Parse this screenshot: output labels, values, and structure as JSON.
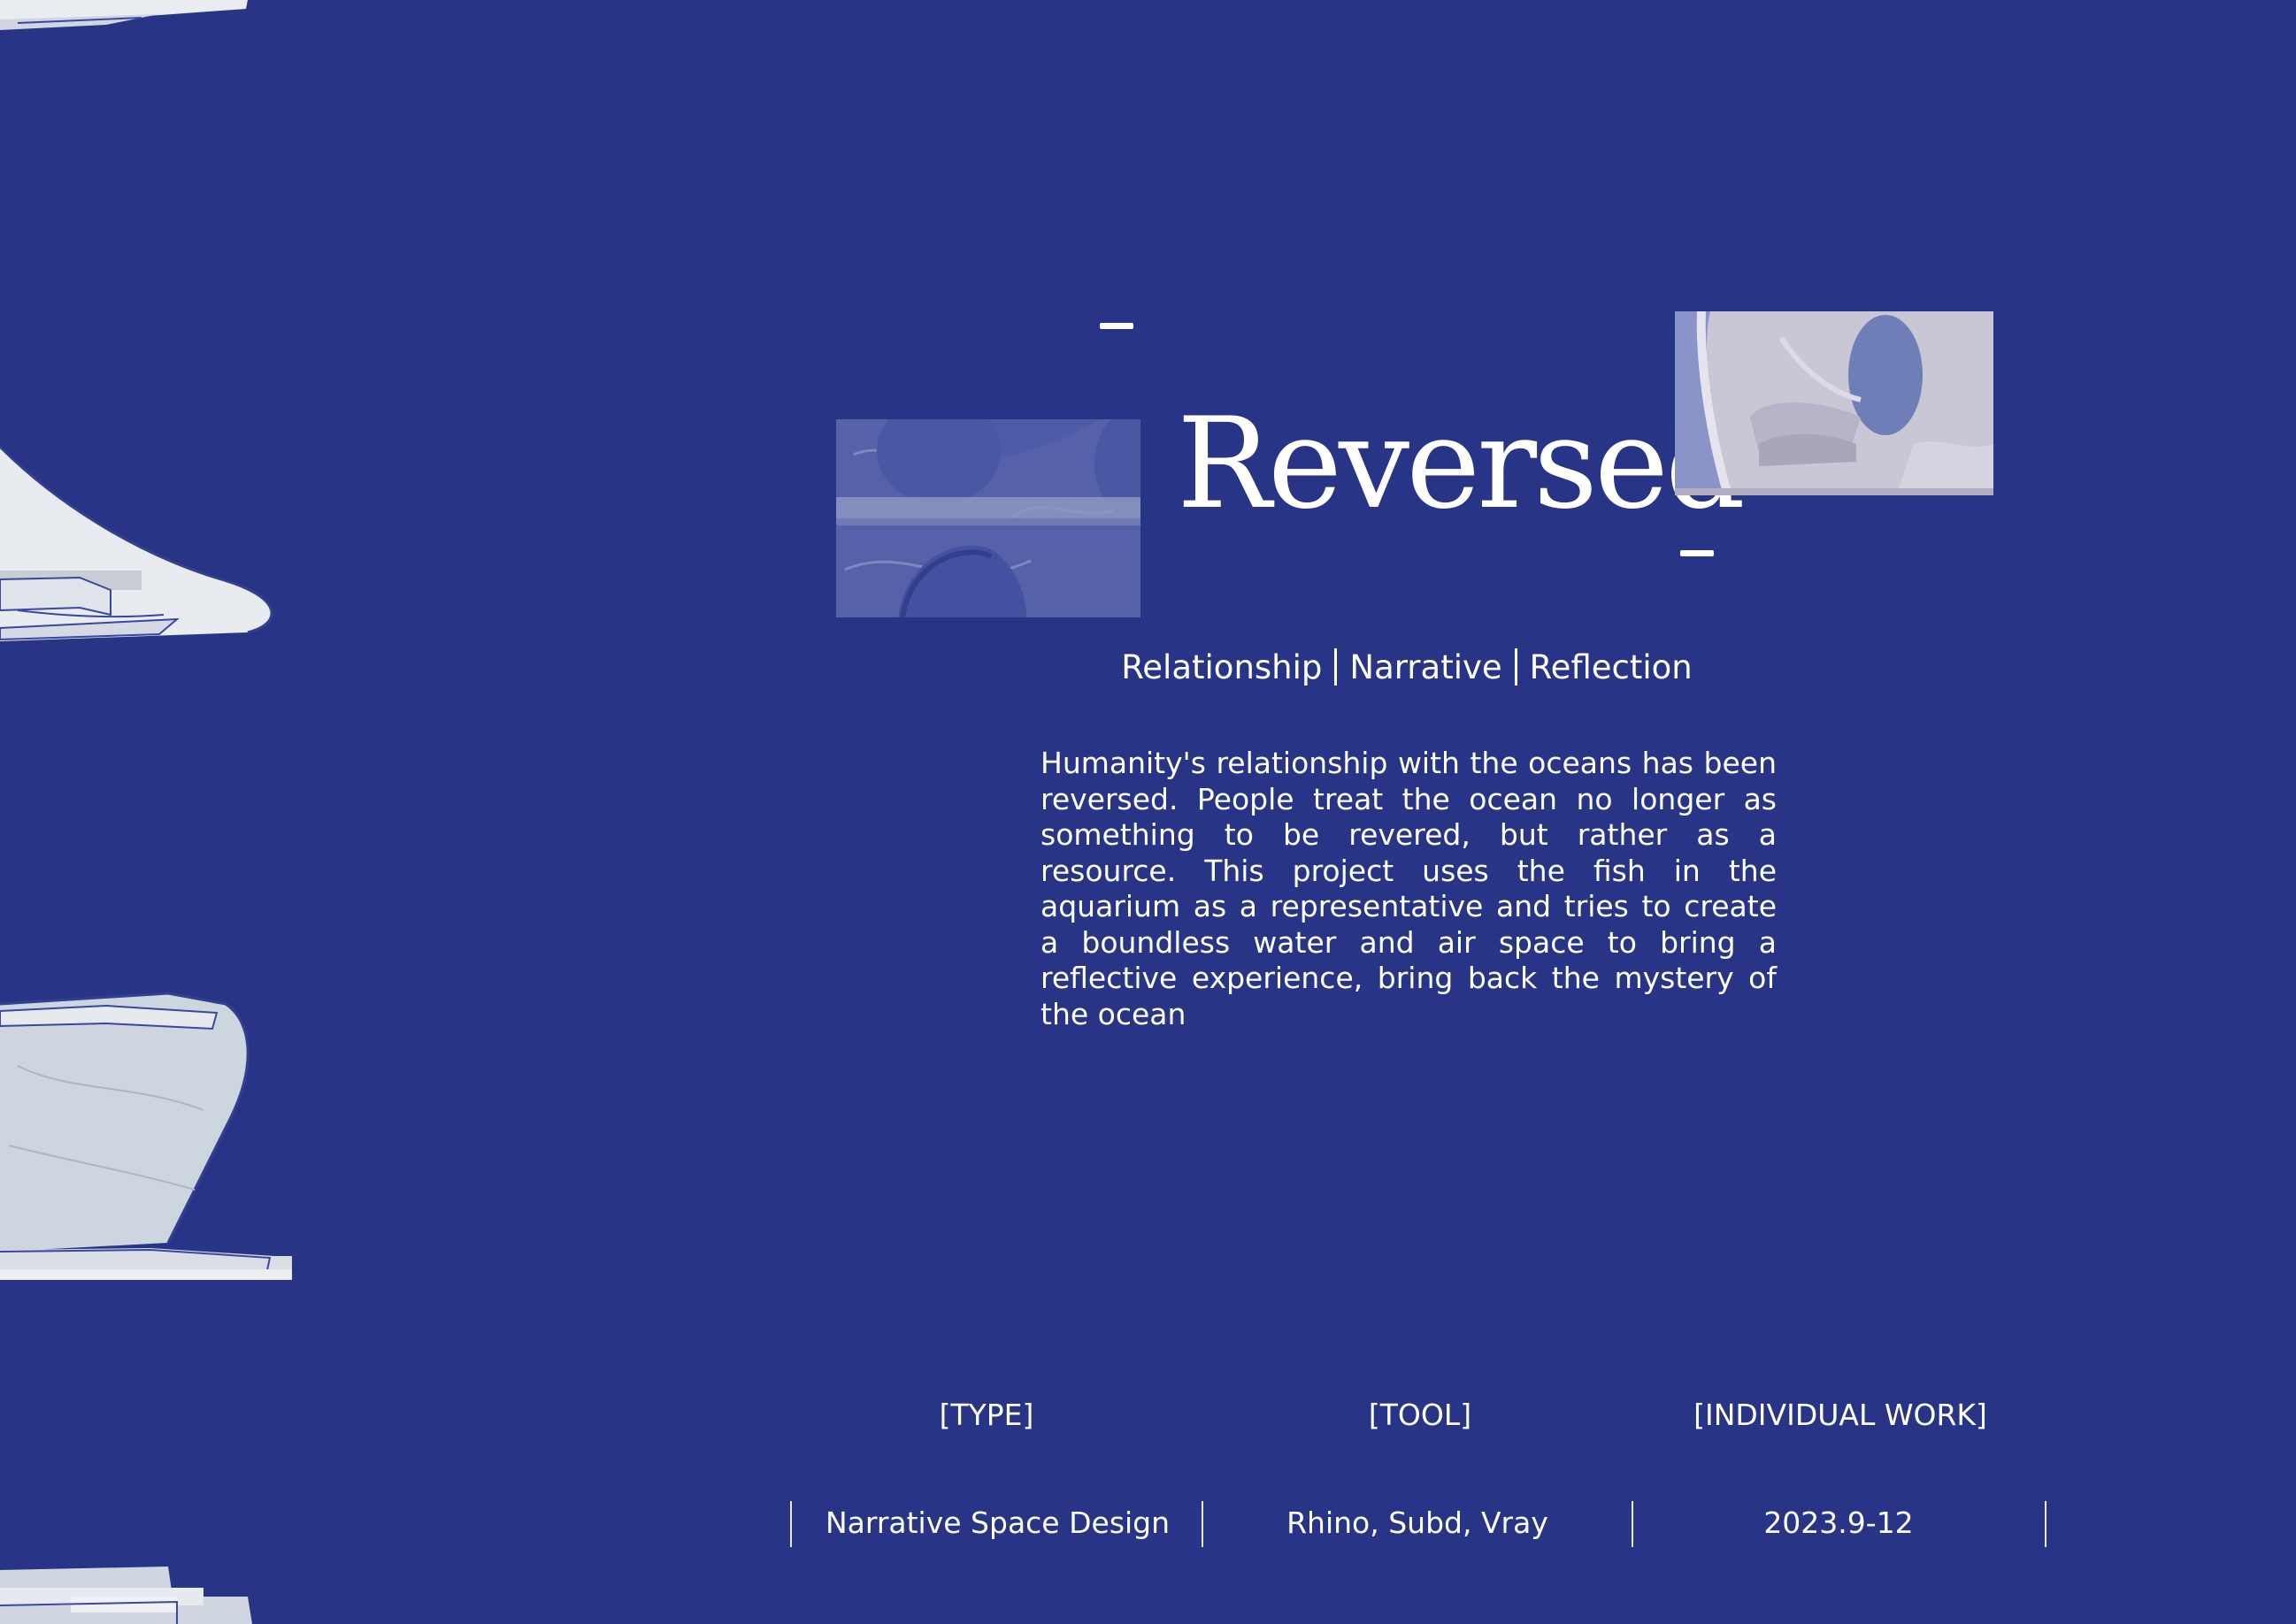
{
  "colors": {
    "background": "#283586",
    "text": "#ffffff",
    "thumb_water": "#4e5ba6",
    "thumb_render": "#c9c6d6"
  },
  "title": "Reversed",
  "tags": [
    "Relationship",
    "Narrative",
    "Reflection"
  ],
  "description": "Humanity's relationship with the oceans has been reversed. People treat the ocean no longer as something to be revered, but rather as a resource. This project uses the fish in the aquarium as a representative and tries to create a boundless water and air space to bring a reflective experience, bring back the mystery of the ocean",
  "info": {
    "type": {
      "label": "[TYPE]",
      "value": "Narrative Space Design"
    },
    "tool": {
      "label": "[TOOL]",
      "value": "Rhino, Subd, Vray"
    },
    "work": {
      "label": "[INDIVIDUAL WORK]",
      "value": "2023.9-12"
    }
  }
}
